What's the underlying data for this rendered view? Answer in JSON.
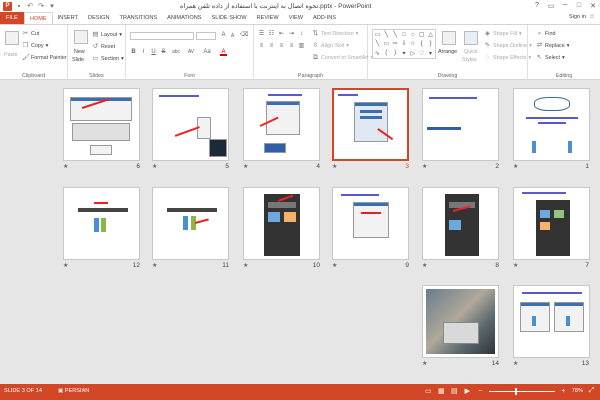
{
  "window": {
    "logo": "P",
    "title": "تحوه اتصال به اینترنت با استفاده از داده تلفن همراه.pptx - PowerPoint",
    "controls": [
      "?",
      "▭",
      "─",
      "□",
      "✕"
    ]
  },
  "qat": {
    "save_icon": "save-icon",
    "undo_icon": "undo-icon",
    "redo_icon": "redo-icon",
    "customize_icon": "customize-icon"
  },
  "tabs": [
    {
      "label": "FILE"
    },
    {
      "label": "HOME"
    },
    {
      "label": "INSERT"
    },
    {
      "label": "DESIGN"
    },
    {
      "label": "TRANSITIONS"
    },
    {
      "label": "ANIMATIONS"
    },
    {
      "label": "SLIDE SHOW"
    },
    {
      "label": "REVIEW"
    },
    {
      "label": "VIEW"
    },
    {
      "label": "ADD-INS"
    }
  ],
  "signin": "Sign in",
  "ribbon": {
    "clipboard": {
      "label": "Clipboard",
      "paste": "Paste",
      "cut": "Cut",
      "copy": "Copy",
      "format_painter": "Format Painter"
    },
    "slides": {
      "label": "Slides",
      "new_slide": "New",
      "new_slide2": "Slide",
      "layout": "Layout",
      "reset": "Reset",
      "section": "Section"
    },
    "font": {
      "label": "Font",
      "bold": "B",
      "italic": "I",
      "underline": "U",
      "strike": "S",
      "shadow": "abc",
      "spacing": "AV",
      "case": "Aa",
      "color": "A",
      "grow": "A",
      "shrink": "A"
    },
    "paragraph": {
      "label": "Paragraph",
      "text_direction": "Text Direction",
      "align_text": "Align Text",
      "convert": "Convert to SmartArt"
    },
    "drawing": {
      "label": "Drawing",
      "arrange": "Arrange",
      "quick": "Quick",
      "styles": "Styles",
      "shape_fill": "Shape Fill",
      "shape_outline": "Shape Outline",
      "shape_effects": "Shape Effects"
    },
    "editing": {
      "label": "Editing",
      "find": "Find",
      "replace": "Replace",
      "select": "Select"
    }
  },
  "slides": [
    {
      "num": "6"
    },
    {
      "num": "5"
    },
    {
      "num": "4"
    },
    {
      "num": "3"
    },
    {
      "num": "2"
    },
    {
      "num": "1"
    },
    {
      "num": "12"
    },
    {
      "num": "11"
    },
    {
      "num": "10"
    },
    {
      "num": "9"
    },
    {
      "num": "8"
    },
    {
      "num": "7"
    },
    {
      "num": "14"
    },
    {
      "num": "13"
    }
  ],
  "status": {
    "slide": "SLIDE 3 OF 14",
    "language": "PERSIAN",
    "zoom": "78%",
    "zoom_fraction": 0.78
  },
  "colors": {
    "accent": "#d24726",
    "selected_slide": "#d24726"
  }
}
